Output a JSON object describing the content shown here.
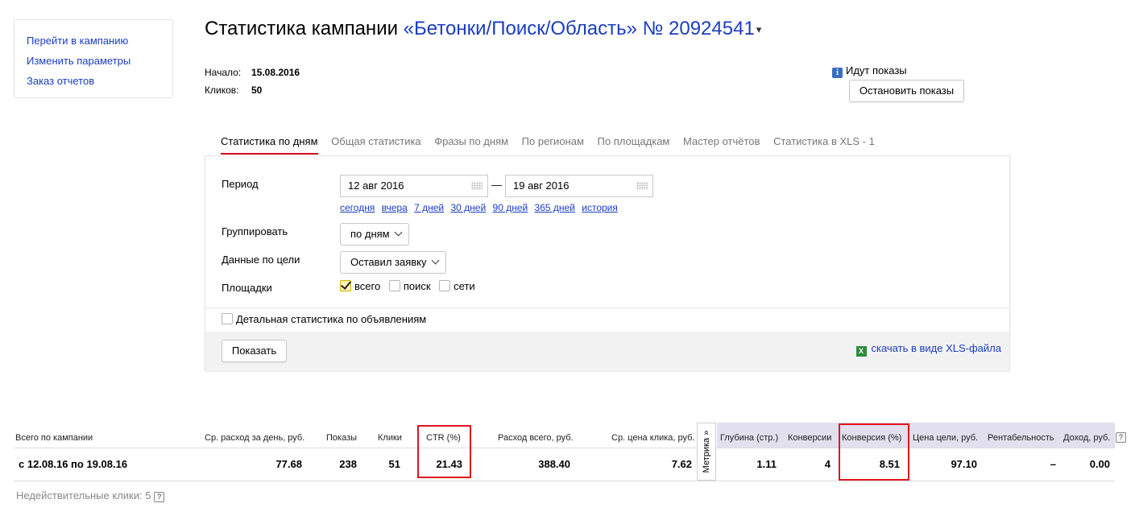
{
  "sidebar": {
    "items": [
      {
        "label": "Перейти в кампанию"
      },
      {
        "label": "Изменить параметры"
      },
      {
        "label": "Заказ отчетов"
      }
    ]
  },
  "header": {
    "title_prefix": "Статистика кампании",
    "campaign_name": "«Бетонки/Поиск/Область»",
    "campaign_number": "№ 20924541",
    "caret": "▾"
  },
  "campaign_meta": {
    "start_label": "Начало:",
    "start_value": "15.08.2016",
    "clicks_label": "Кликов:",
    "clicks_value": "50"
  },
  "status": {
    "text": "Идут показы",
    "icon": "info-icon",
    "stop_button": "Остановить показы"
  },
  "tabs": [
    {
      "label": "Статистика по дням",
      "active": true
    },
    {
      "label": "Общая статистика"
    },
    {
      "label": "Фразы по дням"
    },
    {
      "label": "По регионам"
    },
    {
      "label": "По площадкам"
    },
    {
      "label": "Мастер отчётов"
    },
    {
      "label": "Статистика в XLS - 1"
    }
  ],
  "form": {
    "period_label": "Период",
    "date_from": "12 авг 2016",
    "date_to": "19 авг 2016",
    "dash": "—",
    "quick_periods": [
      "сегодня",
      "вчера",
      "7 дней",
      "30 дней",
      "90 дней",
      "365 дней",
      "история"
    ],
    "group_label": "Группировать",
    "group_value": "по дням",
    "goal_label": "Данные по цели",
    "goal_value": "Оставил заявку",
    "platforms_label": "Площадки",
    "platforms": [
      {
        "label": "всего",
        "checked": true
      },
      {
        "label": "поиск",
        "checked": false
      },
      {
        "label": "сети",
        "checked": false
      }
    ],
    "detail_label": "Детальная статистика по объявлениям",
    "show_button": "Показать",
    "xls_link": "скачать в виде XLS-файла"
  },
  "stats": {
    "metrika_label": "Метрика »",
    "headers": {
      "total": "Всего по кампании",
      "avg_spend": "Ср. расход за день, руб.",
      "impressions": "Показы",
      "clicks": "Клики",
      "ctr": "CTR (%)",
      "spend_total": "Расход всего, руб.",
      "avg_cpc": "Ср. цена клика, руб.",
      "depth": "Глубина (стр.)",
      "conversions": "Конверсии",
      "conversion_rate": "Конверсия (%)",
      "goal_cost": "Цена цели, руб.",
      "profitability": "Рентабельность",
      "income": "Доход, руб."
    },
    "row": {
      "period": "с 12.08.16 по 19.08.16",
      "avg_spend": "77.68",
      "impressions": "238",
      "clicks": "51",
      "ctr": "21.43",
      "spend_total": "388.40",
      "avg_cpc": "7.62",
      "depth": "1.11",
      "conversions": "4",
      "conversion_rate": "8.51",
      "goal_cost": "97.10",
      "profitability": "–",
      "income": "0.00"
    },
    "help_icon": "?",
    "invalid_clicks": "Недействительные клики: 5"
  },
  "colors": {
    "link": "#1a3dc1",
    "active_tab_underline": "#d0021b",
    "highlight_box": "#e0141e",
    "metrika_shade": "#e2dfee"
  }
}
